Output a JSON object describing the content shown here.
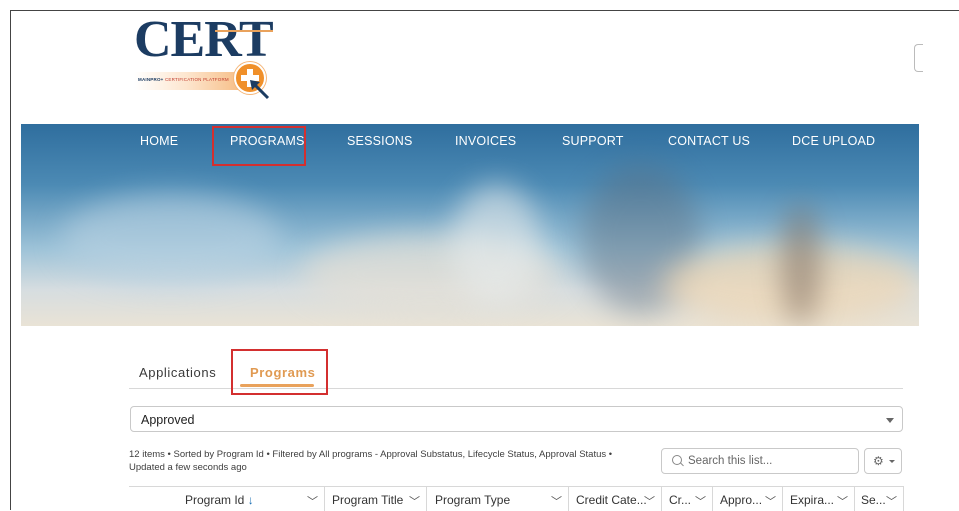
{
  "logo": {
    "word": "CERT",
    "tag_bold": "MAINPRO+",
    "tag_rest": "CERTIFICATION PLATFORM"
  },
  "nav": [
    "HOME",
    "PROGRAMS",
    "SESSIONS",
    "INVOICES",
    "SUPPORT",
    "CONTACT US",
    "DCE UPLOAD"
  ],
  "tabs": {
    "applications": "Applications",
    "programs": "Programs"
  },
  "filter": {
    "selected": "Approved"
  },
  "list_info": {
    "line1": "12 items • Sorted by Program Id • Filtered by All programs - Approval Substatus, Lifecycle Status, Approval Status •",
    "line2": "Updated a few seconds ago"
  },
  "search": {
    "placeholder": "Search this list..."
  },
  "columns": [
    "Program Id",
    "Program Title",
    "Program Type",
    "Credit Cate...",
    "Cr...",
    "Appro...",
    "Expira...",
    "Se..."
  ],
  "sort_arrow": "↓",
  "colors": {
    "nav_accent": "#e9a25c",
    "highlight": "#d32f2f",
    "brand": "#1c3c62"
  }
}
